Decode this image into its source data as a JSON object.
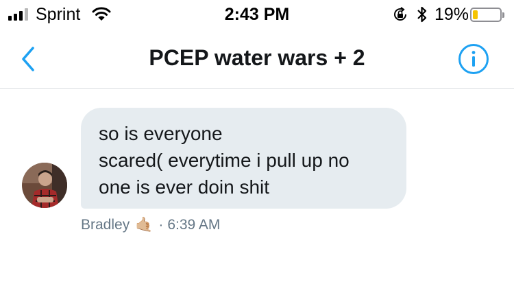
{
  "status_bar": {
    "carrier": "Sprint",
    "time": "2:43 PM",
    "battery_percent": "19%",
    "battery_level": 0.19,
    "battery_color": "#f5c400",
    "signal_bars_filled": 3,
    "signal_bars_total": 4,
    "icons": [
      "signal-icon",
      "wifi-icon",
      "rotation-lock-icon",
      "bluetooth-icon",
      "battery-icon"
    ]
  },
  "header": {
    "title": "PCEP water wars + 2",
    "back_icon": "chevron-left-icon",
    "info_icon": "info-icon",
    "accent": "#1da1f2"
  },
  "conversation": {
    "messages": [
      {
        "sender": "Bradley",
        "sender_emoji": "🤙🏼",
        "time": "6:39 AM",
        "lines": [
          "so is everyone",
          "scared( everytime i pull up no",
          "one is ever doin shit"
        ],
        "bubble_color": "#e6ecf0"
      }
    ]
  }
}
